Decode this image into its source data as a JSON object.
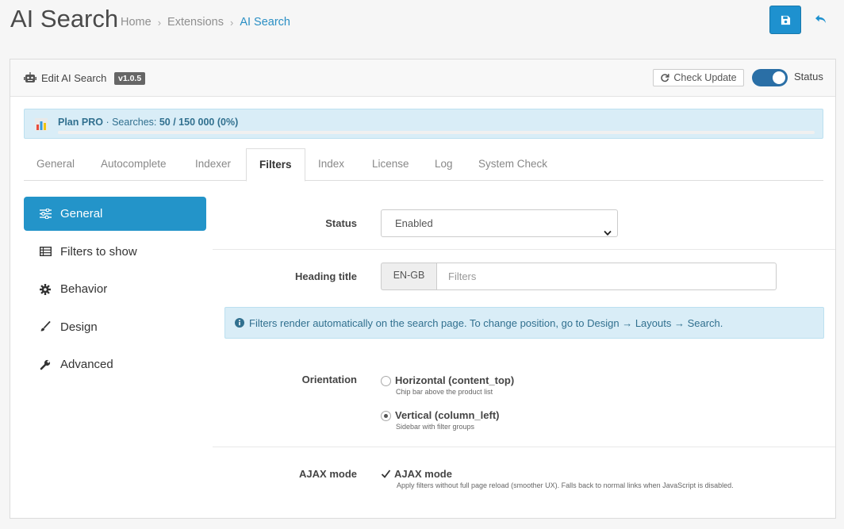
{
  "header": {
    "title": "AI Search",
    "breadcrumb": [
      "Home",
      "Extensions",
      "AI Search"
    ]
  },
  "panel": {
    "title": "Edit AI Search",
    "version": "v1.0.5",
    "check_update_label": "Check Update",
    "status_label": "Status",
    "status_on": true
  },
  "plan": {
    "name": "Plan PRO",
    "searches_label": "· Searches:",
    "searches_value": "50 / 150 000 (0%)",
    "usage_percent": 0
  },
  "tabs": [
    {
      "label": "General",
      "active": false
    },
    {
      "label": "Autocomplete",
      "active": false
    },
    {
      "label": "Indexer",
      "active": false
    },
    {
      "label": "Filters",
      "active": true
    },
    {
      "label": "Index",
      "active": false
    },
    {
      "label": "License",
      "active": false
    },
    {
      "label": "Log",
      "active": false
    },
    {
      "label": "System Check",
      "active": false
    }
  ],
  "sidebar": {
    "items": [
      {
        "label": "General",
        "icon": "sliders-icon",
        "active": true
      },
      {
        "label": "Filters to show",
        "icon": "table-icon",
        "active": false
      },
      {
        "label": "Behavior",
        "icon": "gear-icon",
        "active": false
      },
      {
        "label": "Design",
        "icon": "brush-icon",
        "active": false
      },
      {
        "label": "Advanced",
        "icon": "wrench-icon",
        "active": false
      }
    ]
  },
  "form": {
    "status": {
      "label": "Status",
      "value": "Enabled"
    },
    "heading": {
      "label": "Heading title",
      "lang": "EN-GB",
      "placeholder": "Filters"
    },
    "info": "Filters render automatically on the search page. To change position, go to Design → Layouts → Search.",
    "orientation": {
      "label": "Orientation",
      "options": [
        {
          "title": "Horizontal (content_top)",
          "help": "Chip bar above the product list",
          "checked": false
        },
        {
          "title": "Vertical (column_left)",
          "help": "Sidebar with filter groups",
          "checked": true
        }
      ]
    },
    "ajax": {
      "label": "AJAX mode",
      "option_label": "AJAX mode",
      "help": "Apply filters without full page reload (smoother UX). Falls back to normal links when JavaScript is disabled.",
      "checked": true
    }
  },
  "colors": {
    "primary": "#1e91cf",
    "active_nav": "#2394c9",
    "info_bg": "#d9edf7",
    "info_text": "#31708f"
  }
}
